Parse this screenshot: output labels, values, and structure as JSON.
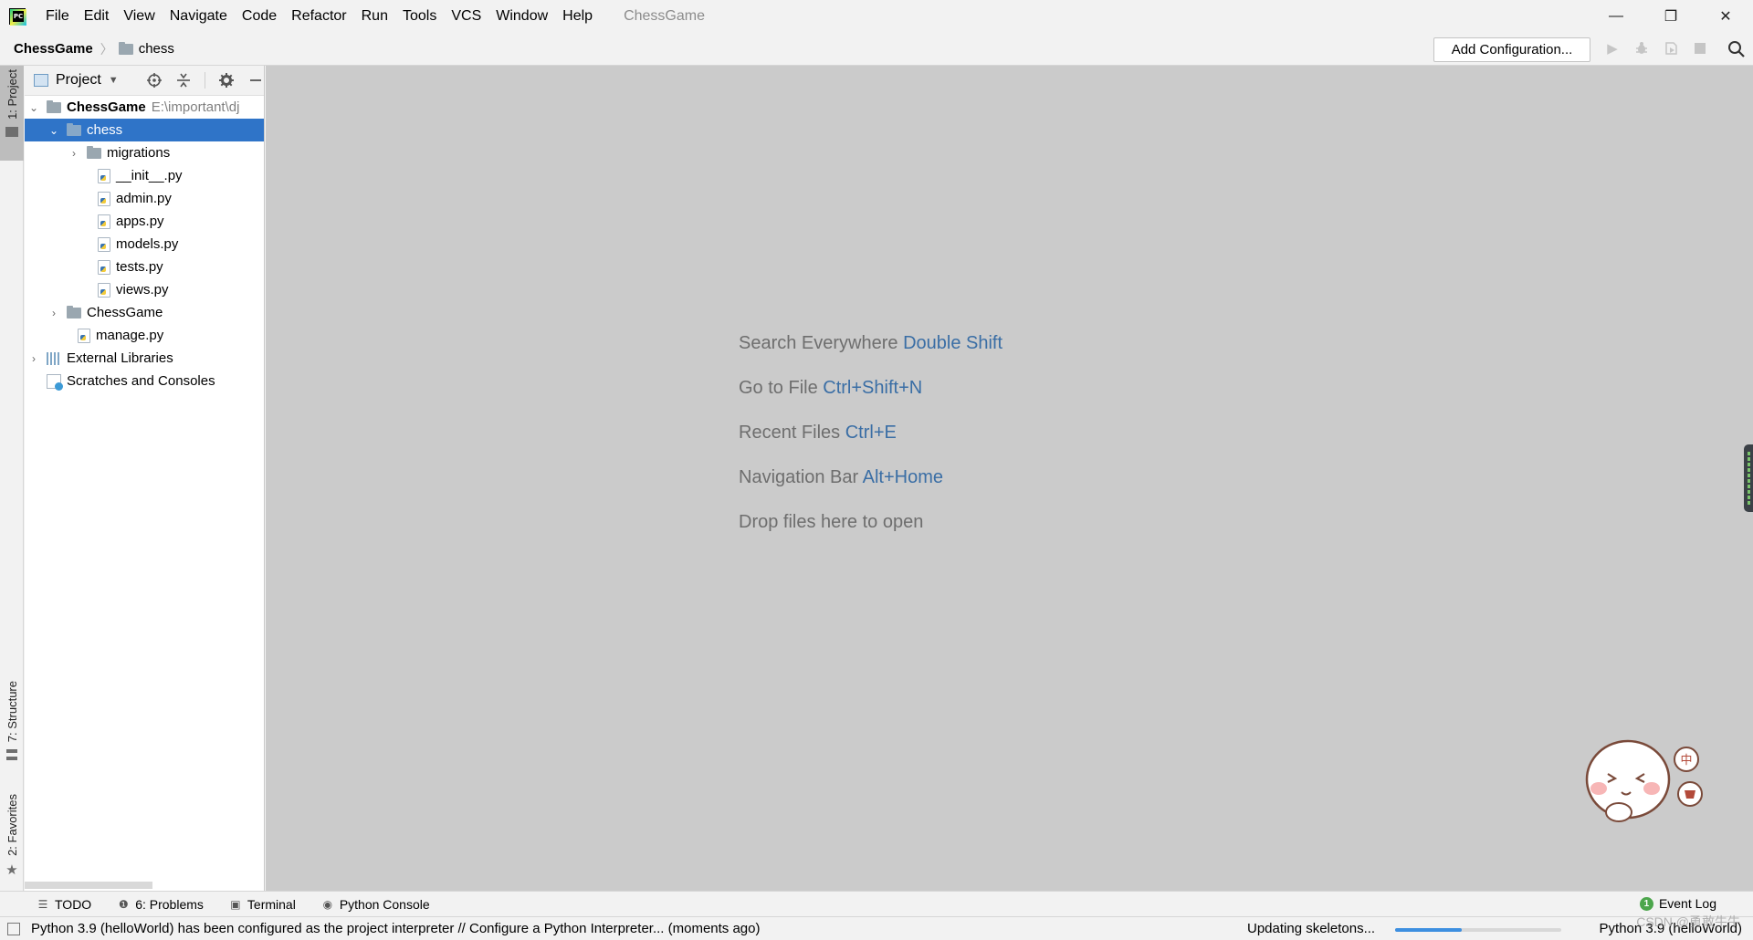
{
  "menu": {
    "items": [
      "File",
      "Edit",
      "View",
      "Navigate",
      "Code",
      "Refactor",
      "Run",
      "Tools",
      "VCS",
      "Window",
      "Help"
    ],
    "window_title": "ChessGame"
  },
  "window_controls": {
    "minimize": "—",
    "restore": "❐",
    "close": "✕"
  },
  "navbar": {
    "root": "ChessGame",
    "separator": "〉",
    "folder": "chess",
    "add_config_label": "Add Configuration..."
  },
  "left_stripe": {
    "project_tab": "1: Project",
    "structure_tab": "7: Structure",
    "favorites_tab": "2: Favorites"
  },
  "project_panel": {
    "title": "Project",
    "tree": {
      "root_name": "ChessGame",
      "root_path": "E:\\important\\dj",
      "chess": "chess",
      "migrations": "migrations",
      "init": "__init__.py",
      "admin": "admin.py",
      "apps": "apps.py",
      "models": "models.py",
      "tests": "tests.py",
      "views": "views.py",
      "chessgame_pkg": "ChessGame",
      "manage": "manage.py",
      "external_libraries": "External Libraries",
      "scratches": "Scratches and Consoles"
    }
  },
  "editor": {
    "hints": [
      {
        "text": "Search Everywhere",
        "key": "Double Shift"
      },
      {
        "text": "Go to File",
        "key": "Ctrl+Shift+N"
      },
      {
        "text": "Recent Files",
        "key": "Ctrl+E"
      },
      {
        "text": "Navigation Bar",
        "key": "Alt+Home"
      },
      {
        "text": "Drop files here to open",
        "key": ""
      }
    ]
  },
  "bottom_tools": {
    "todo": "TODO",
    "problems": "6: Problems",
    "terminal": "Terminal",
    "python_console": "Python Console",
    "event_log": "Event Log",
    "event_count": "1"
  },
  "status": {
    "message": "Python 3.9 (helloWorld) has been configured as the project interpreter // Configure a Python Interpreter... (moments ago)",
    "progress_label": "Updating skeletons...",
    "progress_fraction": 0.4,
    "interpreter": "Python 3.9 (helloWorld)",
    "watermark": "CSDN @勇敢牛牛"
  },
  "colors": {
    "selection": "#2f74c8",
    "hint_key": "#3a6ea5",
    "editor_bg": "#cbcbcb",
    "progress": "#3d8fe0"
  }
}
